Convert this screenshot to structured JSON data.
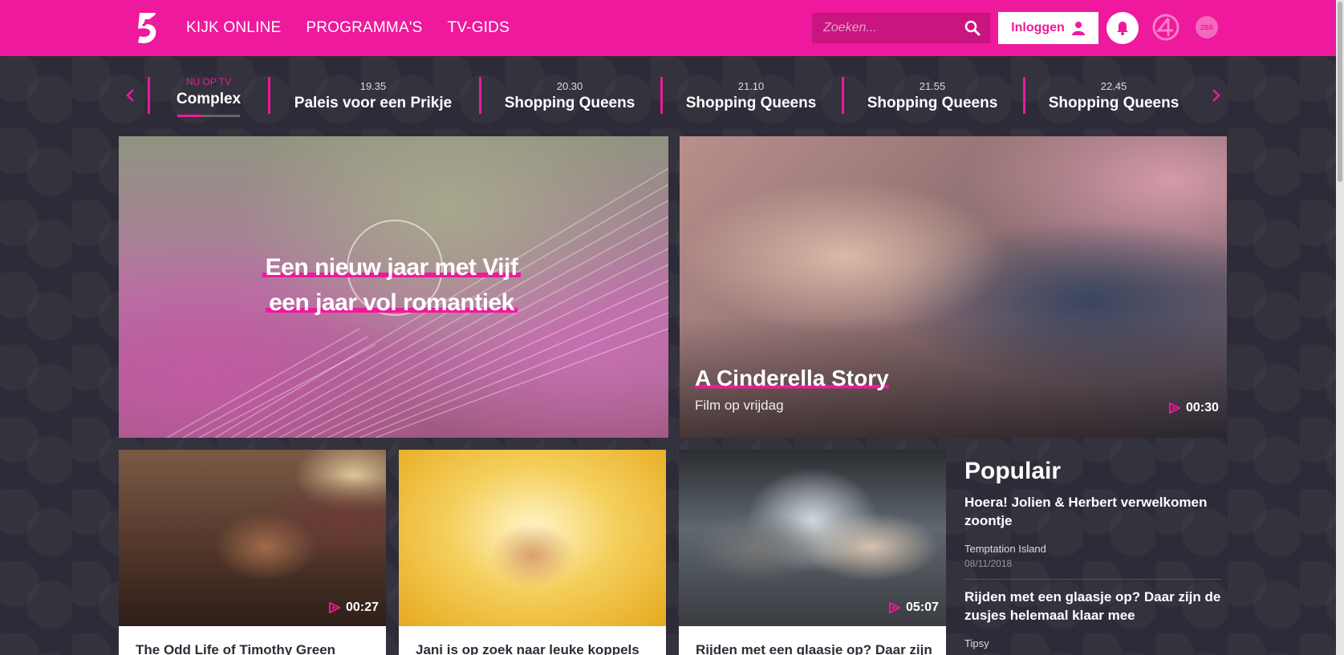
{
  "header": {
    "logo": "5",
    "nav": [
      "KIJK ONLINE",
      "PROGRAMMA'S",
      "TV-GIDS"
    ],
    "search_placeholder": "Zoeken...",
    "login_label": "Inloggen",
    "brand_color": "#ee199c"
  },
  "schedule": {
    "now_label": "NU OP TV",
    "now_title": "Complex",
    "now_progress": 0.4,
    "items": [
      {
        "time": "19.35",
        "title": "Paleis voor een Prikje"
      },
      {
        "time": "20.30",
        "title": "Shopping Queens"
      },
      {
        "time": "21.10",
        "title": "Shopping Queens"
      },
      {
        "time": "21.55",
        "title": "Shopping Queens"
      },
      {
        "time": "22.45",
        "title": "Shopping Queens"
      }
    ]
  },
  "hero": {
    "line1": "Een nieuw jaar met Vijf",
    "line2": "een jaar vol romantiek"
  },
  "feature": {
    "title": "A Cinderella Story",
    "subtitle": "Film op vrijdag",
    "duration": "00:30"
  },
  "cards": [
    {
      "title": "The Odd Life of Timothy Green",
      "duration": "00:27"
    },
    {
      "title": "Jani is op zoek naar leuke koppels",
      "duration": ""
    },
    {
      "title": "Rijden met een glaasje op? Daar zijn",
      "duration": "05:07"
    }
  ],
  "popular": {
    "heading": "Populair",
    "items": [
      {
        "title": "Hoera! Jolien & Herbert verwelkomen zoontje",
        "show": "Temptation Island",
        "date": "08/11/2018"
      },
      {
        "title": "Rijden met een glaasje op? Daar zijn de zusjes helemaal klaar mee",
        "show": "Tipsy",
        "date": ""
      }
    ]
  }
}
